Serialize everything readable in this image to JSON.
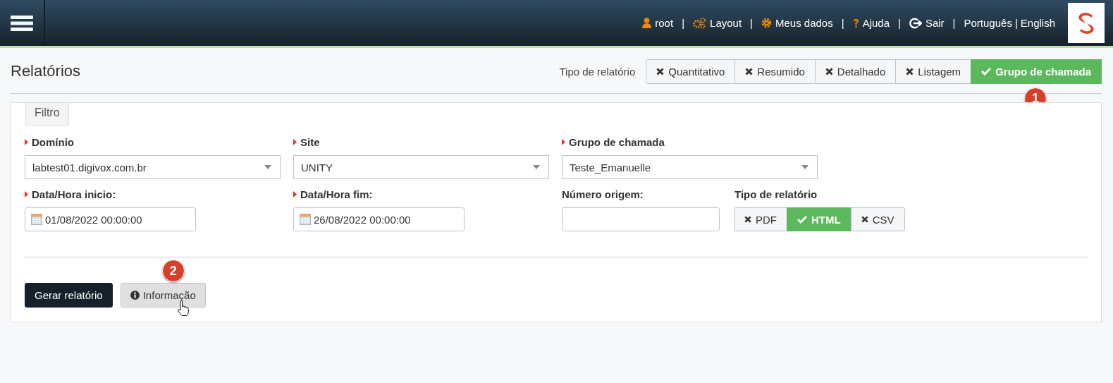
{
  "header": {
    "items": [
      {
        "kind": "user",
        "label": "root"
      },
      {
        "kind": "sep",
        "label": "|"
      },
      {
        "kind": "gears",
        "label": "Layout"
      },
      {
        "kind": "sep",
        "label": "|"
      },
      {
        "kind": "gear",
        "label": "Meus dados"
      },
      {
        "kind": "sep",
        "label": "|"
      },
      {
        "kind": "help",
        "label": "Ajuda"
      },
      {
        "kind": "sep",
        "label": "|"
      },
      {
        "kind": "logout",
        "label": "Sair"
      },
      {
        "kind": "sep",
        "label": "|"
      },
      {
        "kind": "lang",
        "label": "Português"
      },
      {
        "kind": "tight",
        "label": "|"
      },
      {
        "kind": "lang",
        "label": "English"
      }
    ]
  },
  "page": {
    "title": "Relatórios",
    "report_type_label": "Tipo de relatório",
    "report_types": [
      {
        "label": "Quantitativo",
        "selected": false
      },
      {
        "label": "Resumido",
        "selected": false
      },
      {
        "label": "Detalhado",
        "selected": false
      },
      {
        "label": "Listagem",
        "selected": false
      },
      {
        "label": "Grupo de chamada",
        "selected": true
      }
    ]
  },
  "filter": {
    "tab": "Filtro",
    "rows": [
      [
        {
          "kind": "select",
          "label": "Domínio",
          "required": true,
          "value": "labtest01.digivox.com.br"
        },
        {
          "kind": "select",
          "label": "Site",
          "required": true,
          "value": "UNITY"
        },
        {
          "kind": "select",
          "label": "Grupo de chamada",
          "required": true,
          "value": "Teste_Emanuelle"
        }
      ],
      [
        {
          "kind": "date",
          "label": "Data/Hora inicio:",
          "required": true,
          "value": "01/08/2022 00:00:00"
        },
        {
          "kind": "date",
          "label": "Data/Hora fim:",
          "required": true,
          "value": "26/08/2022 00:00:00"
        },
        {
          "kind": "text",
          "label": "Número origem:",
          "required": false
        },
        {
          "kind": "segmented",
          "label": "Tipo de relatório",
          "required": false,
          "options": [
            {
              "label": "PDF",
              "selected": false
            },
            {
              "label": "HTML",
              "selected": true
            },
            {
              "label": "CSV",
              "selected": false
            }
          ]
        }
      ]
    ],
    "buttons": [
      {
        "kind": "primary",
        "label": "Gerar relatório"
      },
      {
        "kind": "info",
        "label": "Informação"
      }
    ]
  },
  "callouts": [
    "1",
    "2"
  ]
}
